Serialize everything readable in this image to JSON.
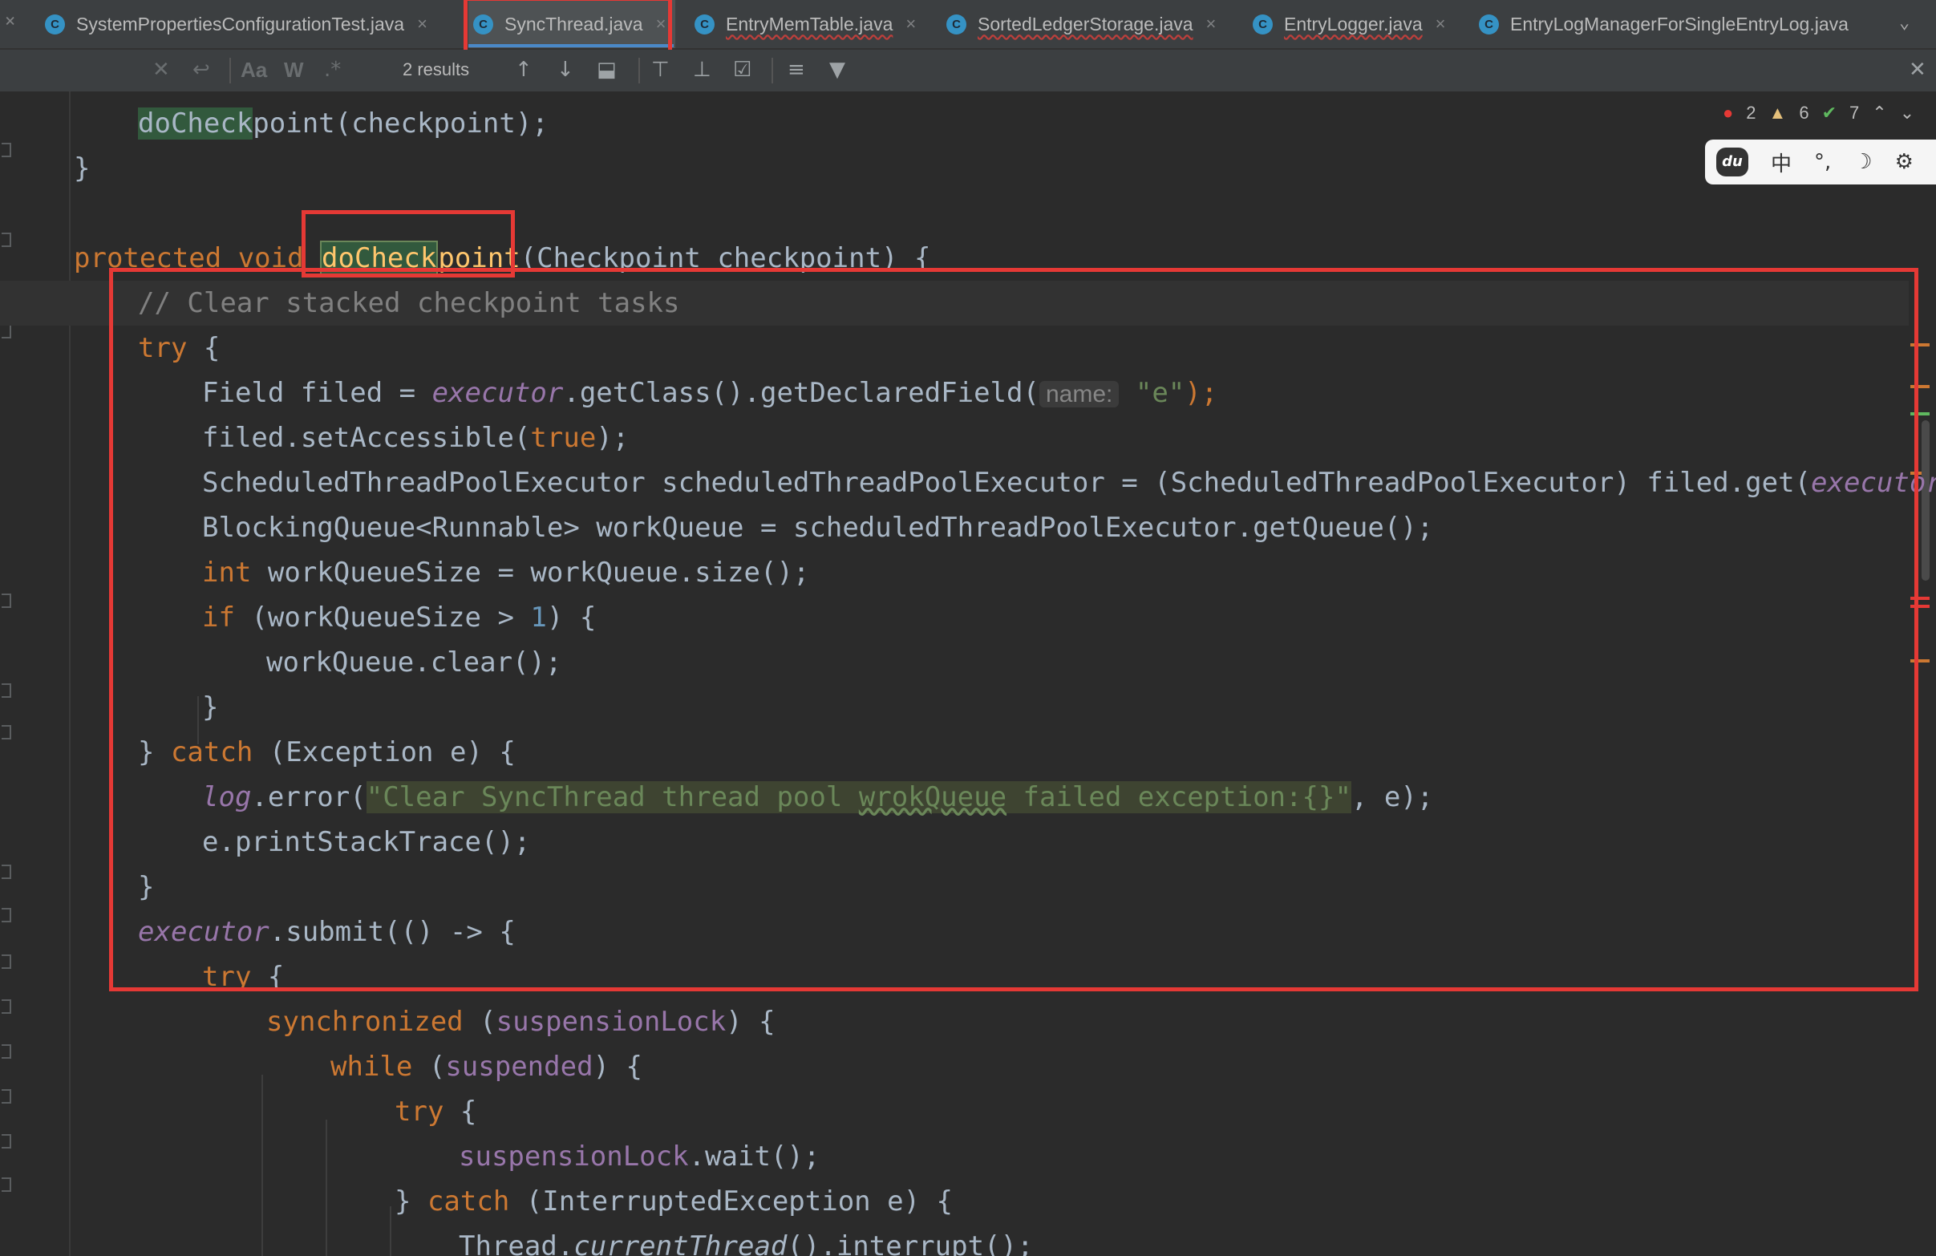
{
  "tabs": [
    {
      "label": "SystemPropertiesConfigurationTest.java",
      "active": false
    },
    {
      "label": "SyncThread.java",
      "active": true
    },
    {
      "label": "EntryMemTable.java",
      "active": false
    },
    {
      "label": "SortedLedgerStorage.java",
      "active": false
    },
    {
      "label": "EntryLogger.java",
      "active": false
    },
    {
      "label": "EntryLogManagerForSingleEntryLog.java",
      "active": false
    }
  ],
  "tab_icon_letter": "C",
  "close_glyph": "×",
  "search": {
    "results_text": "2 results",
    "match_case_label": "Aa",
    "words_label": "W",
    "regex_label": ".*"
  },
  "inspections": {
    "errors": "2",
    "warnings": "6",
    "ok": "7"
  },
  "ime": {
    "logo": "du",
    "lang": "中",
    "punct": "°,",
    "moon": "☽",
    "gear": "⚙"
  },
  "code": {
    "l0_a": "doCheck",
    "l0_b": "point(checkpoint);",
    "l1": "}",
    "l3_kw": "protected void ",
    "l3_fn_a": "doCheck",
    "l3_fn_b": "point",
    "l3_rest": "(Checkpoint checkpoint) {",
    "l4": "// Clear stacked checkpoint tasks",
    "l5_kw": "try",
    "l5_rest": " {",
    "l6_a": "Field filed = ",
    "l6_b": "executor",
    "l6_c": ".getClass().getDeclaredField(",
    "l6_hint": "name:",
    "l6_str": "\"e\"",
    "l6_d": ");",
    "l7_a": "filed.setAccessible(",
    "l7_kw": "true",
    "l7_b": ");",
    "l8_a": "ScheduledThreadPoolExecutor scheduledThreadPoolExecutor = (ScheduledThreadPoolExecutor) filed.get(",
    "l8_b": "executor",
    "l8_c": ");",
    "l9": "BlockingQueue<Runnable> workQueue = scheduledThreadPoolExecutor.getQueue();",
    "l10_kw": "int",
    "l10_rest": " workQueueSize = workQueue.size();",
    "l11_kw": "if",
    "l11_a": " (workQueueSize > ",
    "l11_num": "1",
    "l11_b": ") {",
    "l12": "workQueue.clear();",
    "l13": "}",
    "l14_a": "} ",
    "l14_kw": "catch",
    "l14_b": " (Exception e) {",
    "l15_a": "log",
    "l15_b": ".error(",
    "l15_s1": "\"Clear SyncThread thread pool ",
    "l15_typo": "wrokQueue",
    "l15_s2": " failed exception:{}\"",
    "l15_c": ", e);",
    "l16": "e.printStackTrace();",
    "l17": "}",
    "l18_a": "executor",
    "l18_b": ".submit(() -> {",
    "l19_kw": "try",
    "l19_rest": " {",
    "l20_kw": "synchronized",
    "l20_a": " (",
    "l20_f": "suspensionLock",
    "l20_b": ") {",
    "l21_kw": "while",
    "l21_a": " (",
    "l21_f": "suspended",
    "l21_b": ") {",
    "l22_kw": "try",
    "l22_rest": " {",
    "l23_f": "suspensionLock",
    "l23_rest": ".wait();",
    "l24_a": "} ",
    "l24_kw": "catch",
    "l24_b": " (InterruptedException e) {",
    "l25_a": "Thread.",
    "l25_i": "currentThread",
    "l25_b": "().interrupt();"
  }
}
